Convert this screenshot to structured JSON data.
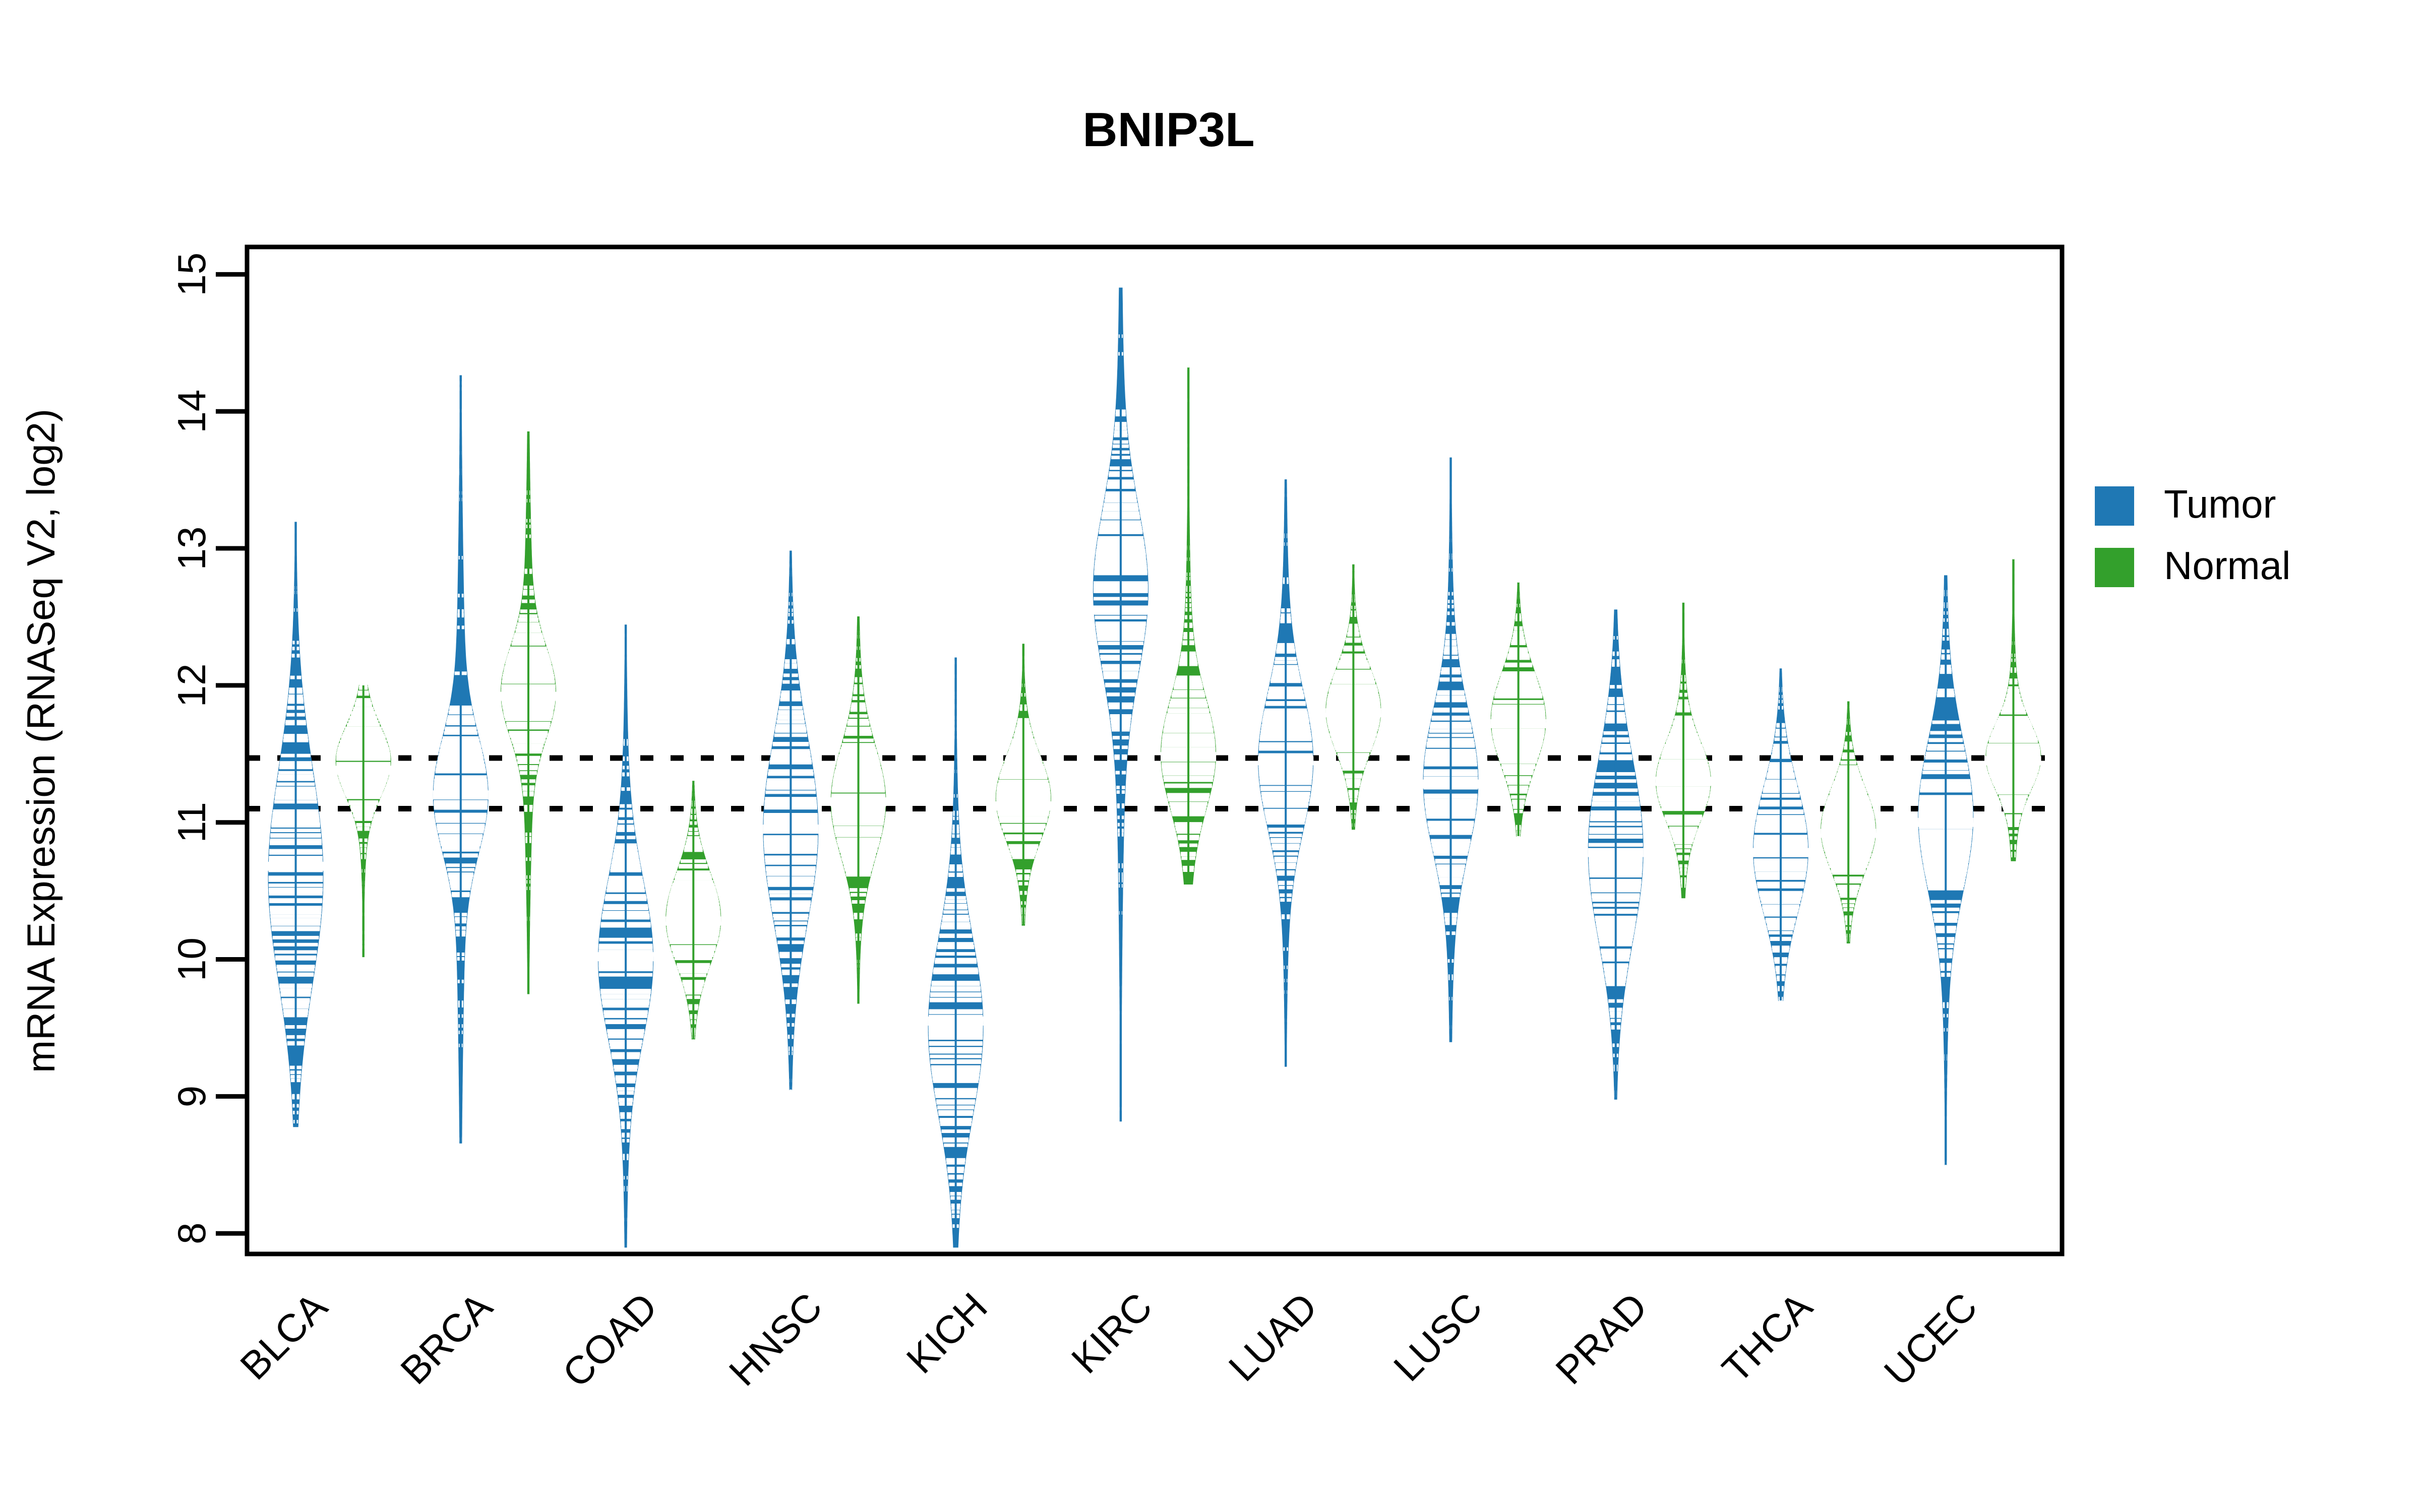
{
  "chart_data": {
    "type": "violin",
    "title": "BNIP3L",
    "xlabel": "",
    "ylabel": "mRNA Expression (RNASeq V2, log2)",
    "ylim": [
      7.85,
      15.2
    ],
    "yticks": [
      8,
      9,
      10,
      11,
      12,
      13,
      14,
      15
    ],
    "ytick_labels": [
      "8",
      "9",
      "10",
      "11",
      "12",
      "13",
      "14",
      "15"
    ],
    "grid": false,
    "legend_position": "right",
    "reference_lines": [
      11.47,
      11.1
    ],
    "categories": [
      "BLCA",
      "BRCA",
      "COAD",
      "HNSC",
      "KICH",
      "KIRC",
      "LUAD",
      "LUSC",
      "PRAD",
      "THCA",
      "UCEC"
    ],
    "series": [
      {
        "name": "Tumor",
        "color": "#1F78B4",
        "groups": [
          {
            "category": "BLCA",
            "median": 10.68,
            "min": 8.78,
            "max": 13.19,
            "q1": 10.0,
            "q3": 11.28,
            "density_peak": 10.6
          },
          {
            "category": "BRCA",
            "median": 11.2,
            "min": 8.66,
            "max": 14.26,
            "q1": 10.82,
            "q3": 11.52,
            "density_peak": 11.2
          },
          {
            "category": "COAD",
            "median": 10.02,
            "min": 7.9,
            "max": 12.44,
            "q1": 9.6,
            "q3": 10.55,
            "density_peak": 10.0
          },
          {
            "category": "HNSC",
            "median": 10.95,
            "min": 9.05,
            "max": 12.98,
            "q1": 10.3,
            "q3": 11.4,
            "density_peak": 10.95
          },
          {
            "category": "KICH",
            "median": 9.55,
            "min": 7.9,
            "max": 12.2,
            "q1": 9.05,
            "q3": 10.1,
            "density_peak": 9.5
          },
          {
            "category": "KIRC",
            "median": 12.55,
            "min": 8.82,
            "max": 14.9,
            "q1": 12.1,
            "q3": 13.1,
            "density_peak": 12.7
          },
          {
            "category": "LUAD",
            "median": 11.45,
            "min": 9.22,
            "max": 13.5,
            "q1": 11.05,
            "q3": 11.88,
            "density_peak": 11.45
          },
          {
            "category": "LUSC",
            "median": 11.28,
            "min": 9.4,
            "max": 13.66,
            "q1": 10.75,
            "q3": 11.6,
            "density_peak": 11.3
          },
          {
            "category": "PRAD",
            "median": 10.78,
            "min": 8.98,
            "max": 12.55,
            "q1": 10.2,
            "q3": 11.3,
            "density_peak": 10.8
          },
          {
            "category": "THCA",
            "median": 10.78,
            "min": 9.7,
            "max": 12.12,
            "q1": 10.35,
            "q3": 11.12,
            "density_peak": 10.8
          },
          {
            "category": "UCEC",
            "median": 11.0,
            "min": 8.5,
            "max": 12.8,
            "q1": 10.5,
            "q3": 11.4,
            "density_peak": 11.05
          }
        ]
      },
      {
        "name": "Normal",
        "color": "#33A02C",
        "groups": [
          {
            "category": "BLCA",
            "median": 11.38,
            "min": 10.02,
            "max": 12.0,
            "q1": 11.18,
            "q3": 11.6,
            "density_peak": 11.45
          },
          {
            "category": "BRCA",
            "median": 11.92,
            "min": 9.75,
            "max": 13.85,
            "q1": 11.65,
            "q3": 12.2,
            "density_peak": 11.95
          },
          {
            "category": "COAD",
            "median": 10.28,
            "min": 9.42,
            "max": 11.3,
            "q1": 10.05,
            "q3": 10.6,
            "density_peak": 10.3
          },
          {
            "category": "HNSC",
            "median": 11.15,
            "min": 9.68,
            "max": 12.5,
            "q1": 10.82,
            "q3": 11.48,
            "density_peak": 11.15
          },
          {
            "category": "KICH",
            "median": 11.12,
            "min": 10.25,
            "max": 12.3,
            "q1": 10.92,
            "q3": 11.42,
            "density_peak": 11.18
          },
          {
            "category": "KIRC",
            "median": 11.48,
            "min": 10.55,
            "max": 14.32,
            "q1": 11.18,
            "q3": 11.85,
            "density_peak": 11.5
          },
          {
            "category": "LUAD",
            "median": 11.8,
            "min": 10.95,
            "max": 12.88,
            "q1": 11.55,
            "q3": 12.05,
            "density_peak": 11.82
          },
          {
            "category": "LUSC",
            "median": 11.72,
            "min": 10.9,
            "max": 12.75,
            "q1": 11.42,
            "q3": 11.98,
            "density_peak": 11.75
          },
          {
            "category": "PRAD",
            "median": 11.3,
            "min": 10.45,
            "max": 12.6,
            "q1": 11.08,
            "q3": 11.55,
            "density_peak": 11.3
          },
          {
            "category": "THCA",
            "median": 10.92,
            "min": 10.12,
            "max": 11.88,
            "q1": 10.65,
            "q3": 11.15,
            "density_peak": 10.95
          },
          {
            "category": "UCEC",
            "median": 11.45,
            "min": 10.72,
            "max": 12.92,
            "q1": 11.25,
            "q3": 11.65,
            "density_peak": 11.48
          }
        ]
      }
    ]
  },
  "legend": {
    "items": [
      {
        "label": "Tumor",
        "color": "#1F78B4"
      },
      {
        "label": "Normal",
        "color": "#33A02C"
      }
    ]
  }
}
